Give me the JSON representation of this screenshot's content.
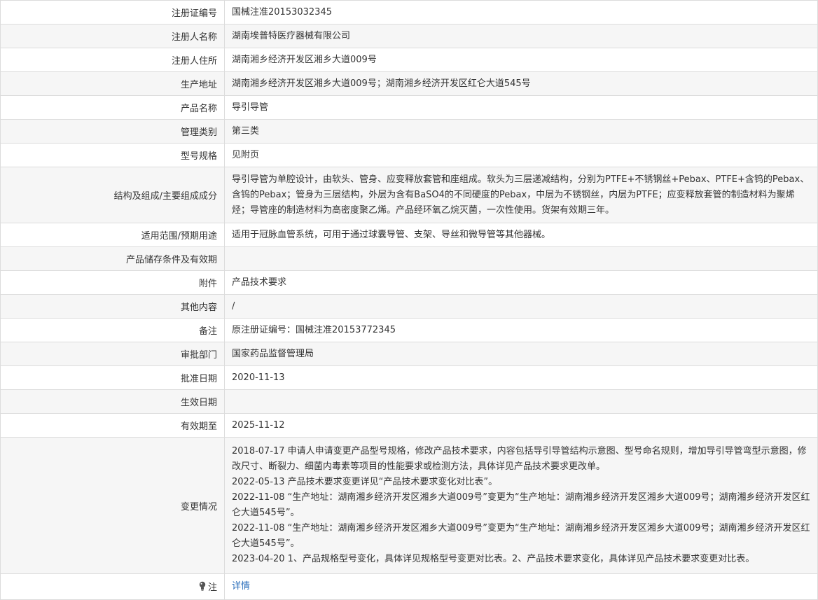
{
  "rows": [
    {
      "label": "注册证编号",
      "value": "国械注准20153032345"
    },
    {
      "label": "注册人名称",
      "value": "湖南埃普特医疗器械有限公司"
    },
    {
      "label": "注册人住所",
      "value": "湖南湘乡经济开发区湘乡大道009号"
    },
    {
      "label": "生产地址",
      "value": "湖南湘乡经济开发区湘乡大道009号；湖南湘乡经济开发区红仑大道545号"
    },
    {
      "label": "产品名称",
      "value": "导引导管"
    },
    {
      "label": "管理类别",
      "value": "第三类"
    },
    {
      "label": "型号规格",
      "value": "见附页"
    },
    {
      "label": "结构及组成/主要组成成分",
      "value": "导引导管为单腔设计，由软头、管身、应变释放套管和座组成。软头为三层递减结构，分别为PTFE+不锈钢丝+Pebax、PTFE+含钨的Pebax、含钨的Pebax；管身为三层结构，外层为含有BaSO4的不同硬度的Pebax，中层为不锈钢丝，内层为PTFE；应变释放套管的制造材料为聚烯烃；导管座的制造材料为高密度聚乙烯。产品经环氧乙烷灭菌，一次性使用。货架有效期三年。"
    },
    {
      "label": "适用范围/预期用途",
      "value": "适用于冠脉血管系统，可用于通过球囊导管、支架、导丝和微导管等其他器械。"
    },
    {
      "label": "产品储存条件及有效期",
      "value": ""
    },
    {
      "label": "附件",
      "value": "产品技术要求"
    },
    {
      "label": "其他内容",
      "value": "/"
    },
    {
      "label": "备注",
      "value": "原注册证编号：国械注准20153772345"
    },
    {
      "label": "审批部门",
      "value": "国家药品监督管理局"
    },
    {
      "label": "批准日期",
      "value": "2020-11-13"
    },
    {
      "label": "生效日期",
      "value": ""
    },
    {
      "label": "有效期至",
      "value": "2025-11-12"
    }
  ],
  "changes": {
    "label": "变更情况",
    "entries": [
      "2018-07-17 申请人申请变更产品型号规格，修改产品技术要求，内容包括导引导管结构示意图、型号命名规则，增加导引导管弯型示意图，修改尺寸、断裂力、细菌内毒素等项目的性能要求或检测方法，具体详见产品技术要求更改单。",
      "2022-05-13 产品技术要求变更详见“产品技术要求变化对比表”。",
      "2022-11-08 “生产地址：湖南湘乡经济开发区湘乡大道009号”变更为“生产地址：湖南湘乡经济开发区湘乡大道009号；湖南湘乡经济开发区红仑大道545号”。",
      "2022-11-08 “生产地址：湖南湘乡经济开发区湘乡大道009号”变更为“生产地址：湖南湘乡经济开发区湘乡大道009号；湖南湘乡经济开发区红仑大道545号”。",
      "2023-04-20 1、产品规格型号变化，具体详见规格型号变更对比表。2、产品技术要求变化，具体详见产品技术要求变更对比表。"
    ]
  },
  "note": {
    "label": "注",
    "icon": "lightbulb-icon",
    "link_text": "详情",
    "link_color": "#2a6ebb"
  }
}
